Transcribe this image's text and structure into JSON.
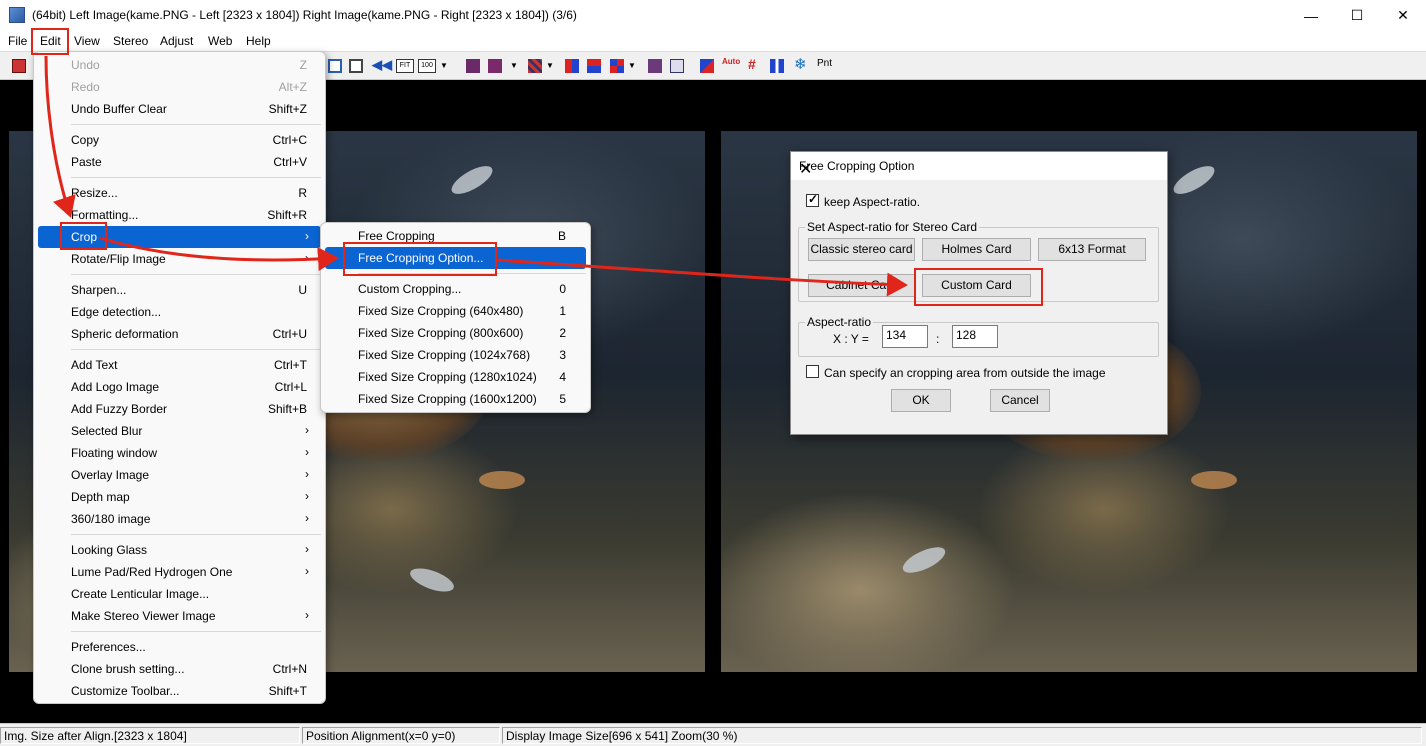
{
  "window": {
    "title": "(64bit) Left Image(kame.PNG - Left [2323 x 1804]) Right Image(kame.PNG - Right [2323 x 1804])  (3/6)",
    "minimize_glyph": "—",
    "maximize_glyph": "☐",
    "close_glyph": "✕"
  },
  "menubar": [
    "File",
    "Edit",
    "View",
    "Stereo",
    "Adjust",
    "Web",
    "Help"
  ],
  "toolbar": {
    "fit_label": "FIT",
    "zoom100_label": "100",
    "auto_label": "Auto",
    "pnt_label": "Pnt"
  },
  "edit_menu": {
    "items": [
      {
        "label": "Undo",
        "shortcut": "Z"
      },
      {
        "label": "Redo",
        "shortcut": "Alt+Z"
      },
      {
        "label": "Undo Buffer Clear",
        "shortcut": "Shift+Z"
      },
      {
        "label": "Copy",
        "shortcut": "Ctrl+C"
      },
      {
        "label": "Paste",
        "shortcut": "Ctrl+V"
      },
      {
        "label": "Resize...",
        "shortcut": "R"
      },
      {
        "label": "Formatting...",
        "shortcut": "Shift+R"
      },
      {
        "label": "Crop",
        "shortcut": ""
      },
      {
        "label": "Rotate/Flip Image",
        "shortcut": ""
      },
      {
        "label": "Sharpen...",
        "shortcut": "U"
      },
      {
        "label": "Edge detection...",
        "shortcut": ""
      },
      {
        "label": "Spheric deformation",
        "shortcut": "Ctrl+U"
      },
      {
        "label": "Add Text",
        "shortcut": "Ctrl+T"
      },
      {
        "label": "Add Logo Image",
        "shortcut": "Ctrl+L"
      },
      {
        "label": "Add Fuzzy Border",
        "shortcut": "Shift+B"
      },
      {
        "label": "Selected Blur",
        "shortcut": ""
      },
      {
        "label": "Floating window",
        "shortcut": ""
      },
      {
        "label": "Overlay Image",
        "shortcut": ""
      },
      {
        "label": "Depth map",
        "shortcut": ""
      },
      {
        "label": "360/180 image",
        "shortcut": ""
      },
      {
        "label": "Looking Glass",
        "shortcut": ""
      },
      {
        "label": "Lume Pad/Red Hydrogen One",
        "shortcut": ""
      },
      {
        "label": "Create Lenticular Image...",
        "shortcut": ""
      },
      {
        "label": "Make Stereo Viewer Image",
        "shortcut": ""
      },
      {
        "label": "Preferences...",
        "shortcut": ""
      },
      {
        "label": "Clone brush setting...",
        "shortcut": "Ctrl+N"
      },
      {
        "label": "Customize Toolbar...",
        "shortcut": "Shift+T"
      }
    ]
  },
  "crop_menu": {
    "items": [
      {
        "label": "Free Cropping",
        "shortcut": "B"
      },
      {
        "label": "Free Cropping Option...",
        "shortcut": ""
      },
      {
        "label": "Custom Cropping...",
        "shortcut": "0"
      },
      {
        "label": "Fixed Size Cropping (640x480)",
        "shortcut": "1"
      },
      {
        "label": "Fixed Size Cropping (800x600)",
        "shortcut": "2"
      },
      {
        "label": "Fixed Size Cropping (1024x768)",
        "shortcut": "3"
      },
      {
        "label": "Fixed Size Cropping (1280x1024)",
        "shortcut": "4"
      },
      {
        "label": "Fixed Size Cropping (1600x1200)",
        "shortcut": "5"
      }
    ]
  },
  "dialog": {
    "title": "Free Cropping Option",
    "keep_aspect_label": "keep Aspect-ratio.",
    "keep_aspect_checked": true,
    "stereo_group_label": "Set Aspect-ratio for Stereo Card",
    "card_buttons": [
      "Classic stereo card",
      "Holmes Card",
      "6x13 Format",
      "Cabinet Card",
      "Custom Card"
    ],
    "aspect_group_label": "Aspect-ratio",
    "xy_label": "X : Y =",
    "x_value": "134",
    "colon": ":",
    "y_value": "128",
    "outside_label": "Can specify an cropping area from outside the image",
    "outside_checked": false,
    "ok_label": "OK",
    "cancel_label": "Cancel"
  },
  "statusbar": {
    "size_after_align": "Img. Size after Align.[2323 x 1804]",
    "position_alignment": "Position Alignment(x=0 y=0)",
    "display_size": "Display Image Size[696 x 541]  Zoom(30 %)"
  },
  "colors": {
    "highlight": "#0a64d2",
    "annotation": "#e0261b"
  }
}
